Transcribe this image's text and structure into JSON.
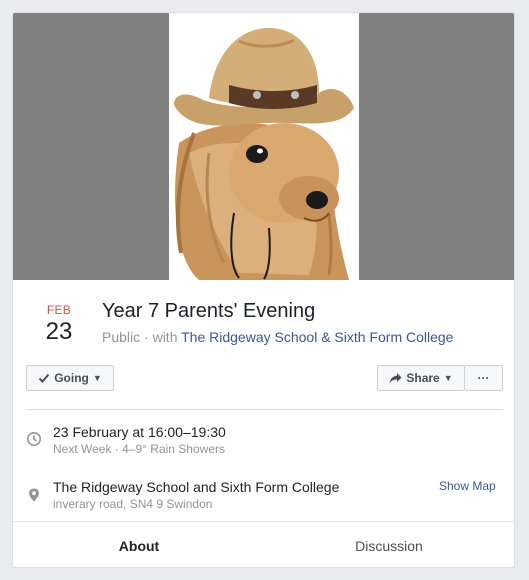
{
  "event": {
    "month": "FEB",
    "day": "23",
    "title": "Year 7 Parents' Evening",
    "privacy": "Public",
    "with_text": "· with",
    "host": "The Ridgeway School & Sixth Form College"
  },
  "actions": {
    "going_label": "Going",
    "share_label": "Share",
    "more_label": "···"
  },
  "details": {
    "time_title": "23 February at 16:00–19:30",
    "time_sub": "Next Week · 4–9° Rain Showers",
    "location_title": "The Ridgeway School and Sixth Form College",
    "location_sub": "inverary road, SN4 9 Swindon",
    "show_map_label": "Show Map"
  },
  "tabs": [
    {
      "label": "About",
      "active": true
    },
    {
      "label": "Discussion",
      "active": false
    }
  ],
  "colors": {
    "accent": "#4267b2",
    "link": "#365899",
    "month": "#e04a43",
    "cover_bg": "#808080"
  },
  "icons": {
    "going": "check-icon",
    "share": "share-arrow-icon",
    "time": "clock-icon",
    "location": "map-pin-icon"
  }
}
